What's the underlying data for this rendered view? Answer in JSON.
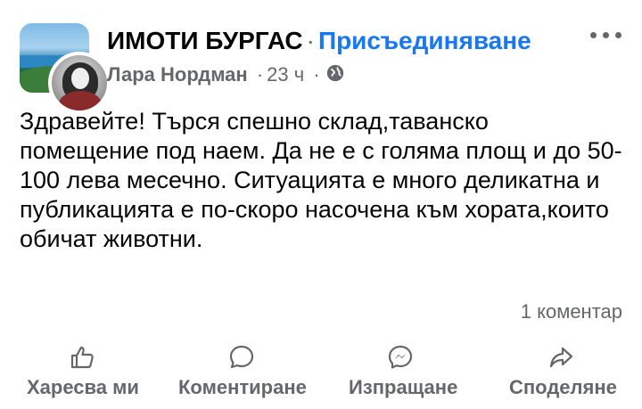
{
  "header": {
    "group_name": "ИМОТИ БУРГАС",
    "separator": "·",
    "join_label": "Присъединяване",
    "author": "Лара Нордман",
    "time": "23 ч",
    "meta_separator": "·",
    "privacy_icon": "globe-icon",
    "more_icon": "more-options-icon"
  },
  "post": {
    "text": "Здравейте! Търся спешно склад,таванско помещение под наем. Да не е с голяма площ и до 50-100 лева месечно. Ситуацията е много деликатна и публикацията е по-скоро насочена към хората,които обичат животни."
  },
  "stats": {
    "comments": "1 коментар"
  },
  "actions": {
    "like": {
      "label": "Харесва ми",
      "icon": "thumbs-up-icon"
    },
    "comment": {
      "label": "Коментиране",
      "icon": "comment-bubble-icon"
    },
    "send": {
      "label": "Изпращане",
      "icon": "messenger-icon"
    },
    "share": {
      "label": "Споделяне",
      "icon": "share-arrow-icon"
    }
  },
  "colors": {
    "text": "#050505",
    "secondary": "#65676b",
    "link": "#1877f2",
    "background": "#ffffff"
  }
}
